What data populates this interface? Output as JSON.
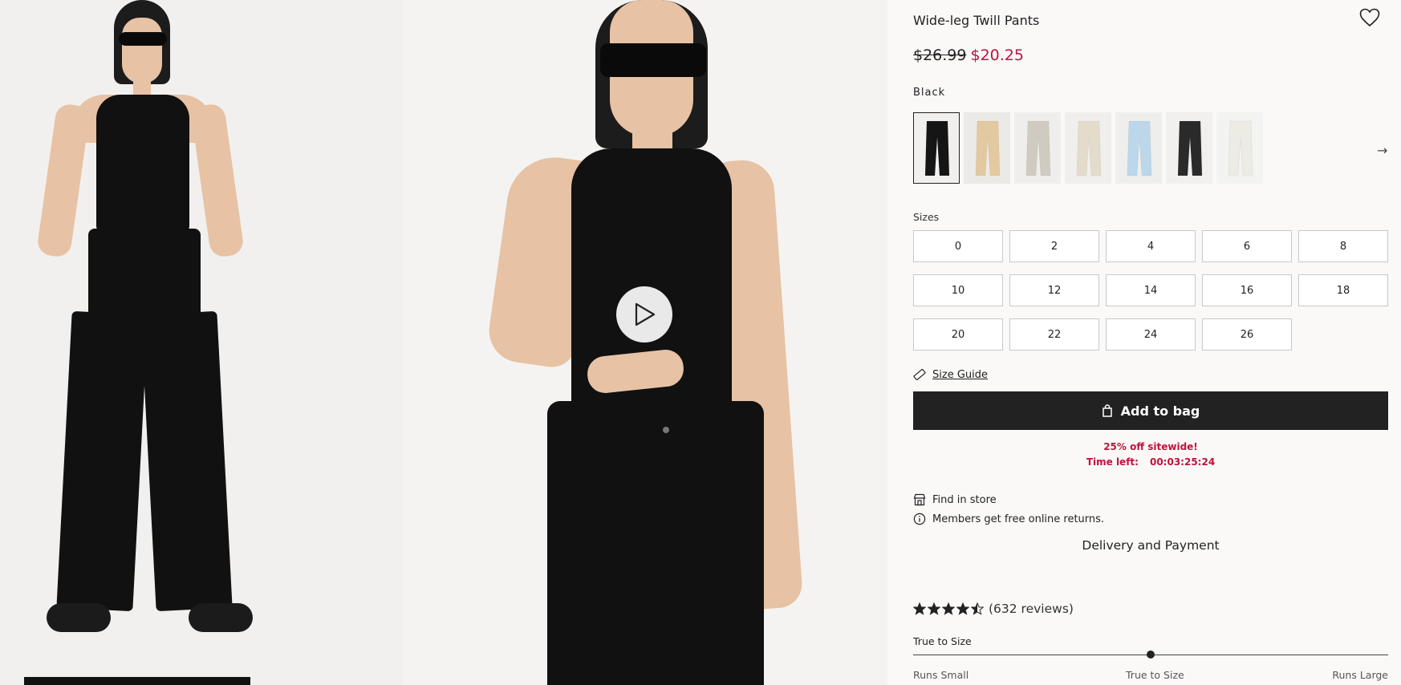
{
  "product": {
    "title": "Wide-leg Twill Pants",
    "original_price": "$26.99",
    "sale_price": "$20.25",
    "color_name": "Black",
    "sale_color": "#c0123c"
  },
  "swatches": [
    {
      "color": "#151515",
      "bg": "#f1f0ee",
      "selected": true
    },
    {
      "color": "#e2c9a0",
      "bg": "#eceae7",
      "selected": false
    },
    {
      "color": "#cfcbc0",
      "bg": "#efeeec",
      "selected": false
    },
    {
      "color": "#e4dccb",
      "bg": "#f0efed",
      "selected": false
    },
    {
      "color": "#bcd6ea",
      "bg": "#eeeeed",
      "selected": false
    },
    {
      "color": "#2a2a2a",
      "bg": "#f1f0ee",
      "selected": false
    },
    {
      "color": "#ecebe4",
      "bg": "#f3f3f1",
      "selected": false
    }
  ],
  "sizes": {
    "label": "Sizes",
    "options": [
      "0",
      "2",
      "4",
      "6",
      "8",
      "10",
      "12",
      "14",
      "16",
      "18",
      "20",
      "22",
      "24",
      "26"
    ]
  },
  "size_guide_label": "Size Guide",
  "add_to_bag_label": "Add to bag",
  "promo": {
    "line1": "25% off sitewide!",
    "time_label": "Time left:",
    "countdown": "00:03:25:24"
  },
  "find_in_store_label": "Find in store",
  "members_note": "Members get free online returns.",
  "delivery_label": "Delivery and Payment",
  "rating": {
    "stars": 4.5,
    "reviews_text": "(632 reviews)"
  },
  "fit": {
    "label": "True to Size",
    "value": 0.5,
    "scale": [
      "Runs Small",
      "True to Size",
      "Runs Large"
    ]
  },
  "icons": [
    "heart-icon",
    "arrow-right-icon",
    "ruler-icon",
    "bag-icon",
    "store-icon",
    "info-icon",
    "star-icon",
    "play-icon"
  ]
}
